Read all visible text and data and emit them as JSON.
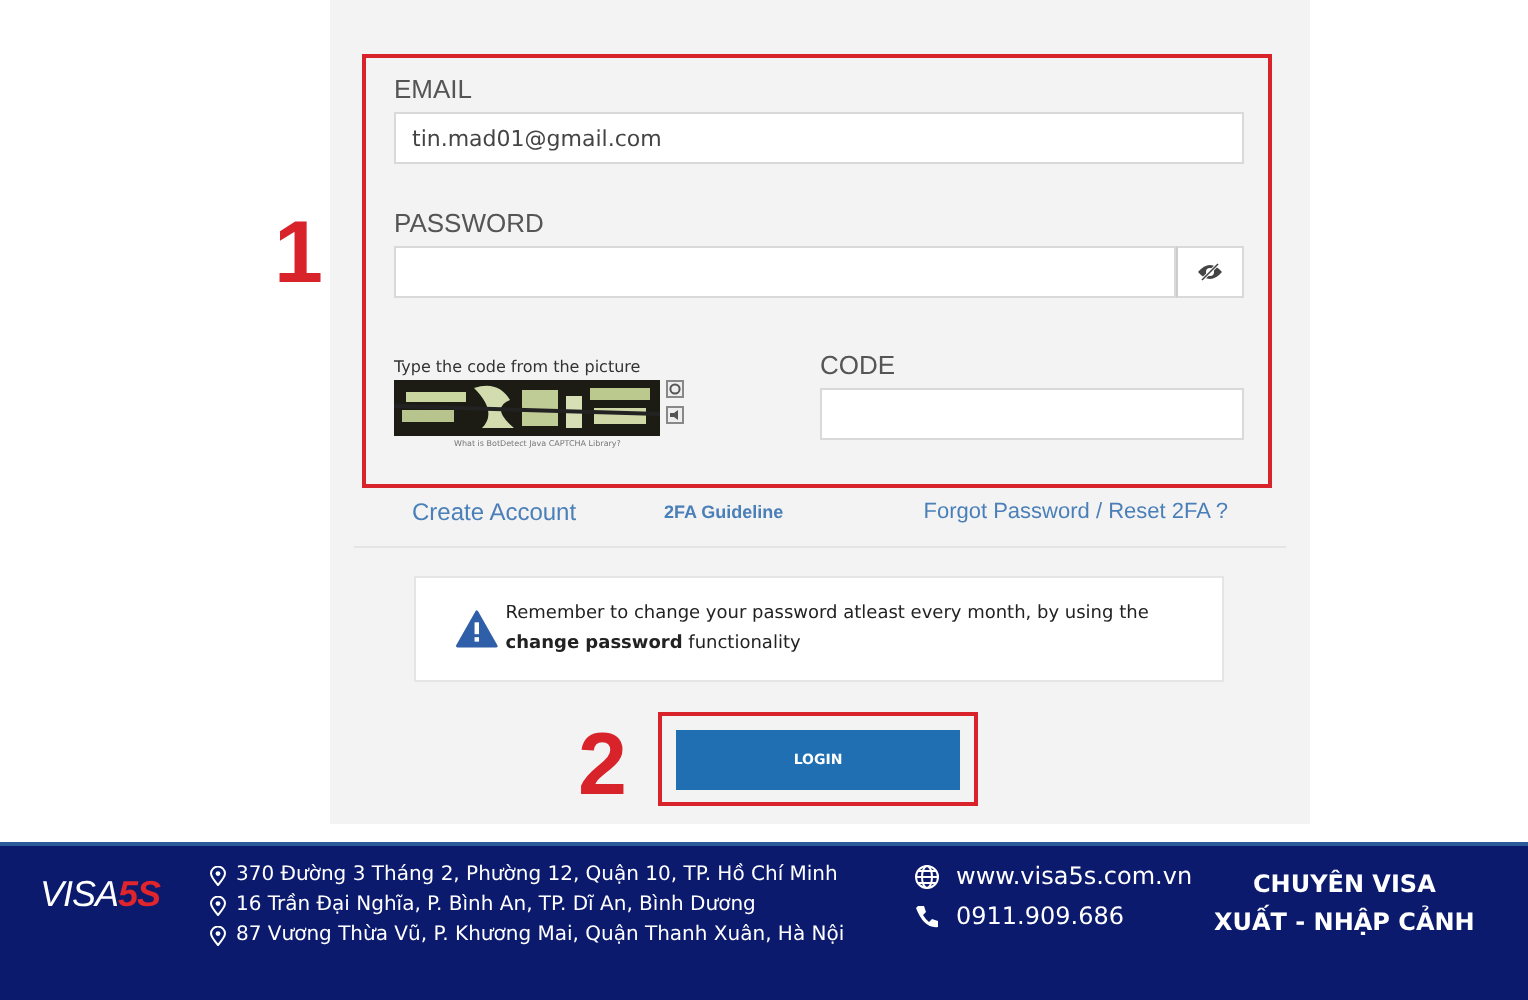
{
  "annotations": [
    {
      "number": "1"
    },
    {
      "number": "2"
    }
  ],
  "form": {
    "email_label": "EMAIL",
    "email_value": "tin.mad01@gmail.com",
    "password_label": "PASSWORD",
    "captcha_prompt": "Type the code from the picture",
    "captcha_caption": "What is BotDetect Java CAPTCHA Library?",
    "code_label": "CODE"
  },
  "links": [
    "Create Account",
    "2FA Guideline",
    "Forgot Password / Reset 2FA ?"
  ],
  "notice": {
    "text": "Remember to change your password atleast every month, by using the **change password** functionality"
  },
  "login_button": "LOGIN",
  "footer": {
    "logo": {
      "part_1": "VISA",
      "part_2": "5S"
    },
    "addresses": [
      "370 Đường 3 Tháng 2, Phường 12, Quận 10, TP. Hồ Chí Minh",
      "16 Trần Đại Nghĩa, P. Bình An, TP. Dĩ An, Bình Dương",
      "87 Vương Thừa Vũ, P. Khương Mai, Quận Thanh Xuân, Hà Nội"
    ],
    "contacts": [
      {
        "kind": "web",
        "text": "www.visa5s.com.vn"
      },
      {
        "kind": "phone",
        "text": "0911.909.686"
      }
    ],
    "slogan": [
      "CHUYÊN VISA",
      "XUẤT - NHẬP CẢNH"
    ]
  }
}
